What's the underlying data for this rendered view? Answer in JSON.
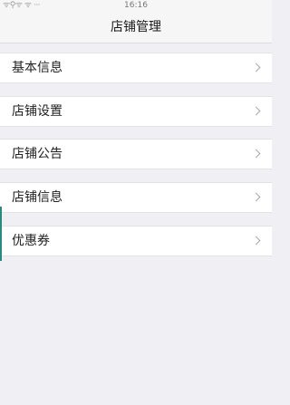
{
  "status_bar": {
    "icons_text": "ᯤ⚲ᯤ ᯤ ···",
    "time": "16:16"
  },
  "header": {
    "title": "店铺管理"
  },
  "menu": {
    "items": [
      {
        "label": "基本信息"
      },
      {
        "label": "店铺设置"
      },
      {
        "label": "店铺公告"
      },
      {
        "label": "店铺信息"
      },
      {
        "label": "优惠券"
      }
    ]
  }
}
